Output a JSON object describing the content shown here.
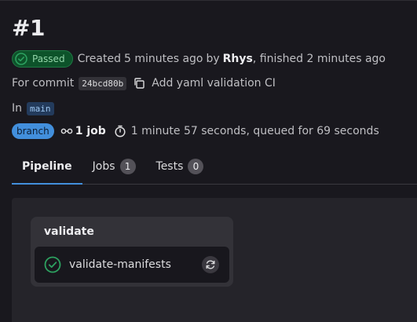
{
  "pipeline": {
    "title": "#1",
    "status_label": "Passed",
    "created_prefix": "Created",
    "created_ago": "5 minutes ago",
    "by_label": "by",
    "author": "Rhys",
    "finished_text": ", finished 2 minutes ago"
  },
  "commit": {
    "prefix": "For commit",
    "sha": "24bcd80b",
    "message": "Add yaml validation CI"
  },
  "ref": {
    "prefix": "In",
    "branch": "main"
  },
  "meta": {
    "ref_type_badge": "branch",
    "jobs_count": "1 job",
    "duration_text": "1 minute 57 seconds, queued for 69 seconds"
  },
  "tabs": [
    {
      "label": "Pipeline",
      "active": true
    },
    {
      "label": "Jobs",
      "count": "1"
    },
    {
      "label": "Tests",
      "count": "0"
    }
  ],
  "graph": {
    "stage_name": "validate",
    "job_name": "validate-manifests"
  },
  "colors": {
    "success": "#2da160",
    "accent": "#428fdc",
    "background": "#19181e"
  },
  "icons": {
    "status": "check-circle-icon",
    "copy": "copy-icon",
    "jobs": "pipeline-icon",
    "timer": "timer-icon",
    "retry": "retry-icon"
  }
}
